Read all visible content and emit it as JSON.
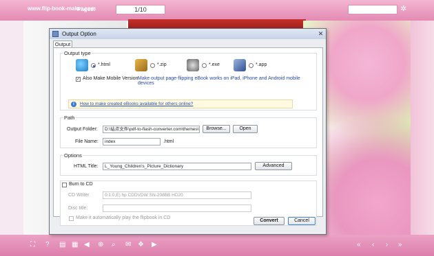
{
  "topbar": {
    "site": "www.flip-book-maker.com",
    "pages_label": "Pages:",
    "page_value": "1/10"
  },
  "dialog": {
    "title": "Output Option",
    "tab": "Output",
    "output_type": {
      "title": "Output type",
      "options": [
        {
          "label": "*.html",
          "selected": true,
          "icon": "globe-icon"
        },
        {
          "label": "*.zip",
          "selected": false,
          "icon": "zip-icon"
        },
        {
          "label": "*.exe",
          "selected": false,
          "icon": "exe-icon"
        },
        {
          "label": "*.app",
          "selected": false,
          "icon": "mac-app-icon"
        }
      ]
    },
    "mobile": {
      "checkbox_label": "Also Make Mobile Version",
      "checked": true,
      "note": "Make output page-flipping eBook works on iPad, iPhone and Android mobile devices"
    },
    "info_link": "How to make created eBooks available for others online?",
    "path": {
      "title": "Path",
      "folder_label": "Output Folder:",
      "folder_value": "D:\\站点文件\\pdf-to-flash-converter.com\\themes\\",
      "browse": "Browse...",
      "open": "Open",
      "file_label": "File Name:",
      "file_value": "index",
      "ext": ".html"
    },
    "options": {
      "title": "Options",
      "html_title_label": "HTML Title:",
      "html_title_value": "L_Young_Children's_Picture_Dictionary",
      "advanced": "Advanced"
    },
    "cd": {
      "burn_label": "Burn to CD",
      "checked": false,
      "writer_label": "CD Writer",
      "writer_value": "0:1:0,E) hp     CDDVDW SN-208BB  HD20",
      "disc_label": "Disc title:",
      "disc_value": "",
      "autoplay_label": "Make it automatically play the flipbook in CD"
    },
    "convert": "Convert",
    "cancel": "Cancel"
  },
  "colors": {
    "accent": "#e48ab4",
    "link": "#1f4fb0"
  }
}
